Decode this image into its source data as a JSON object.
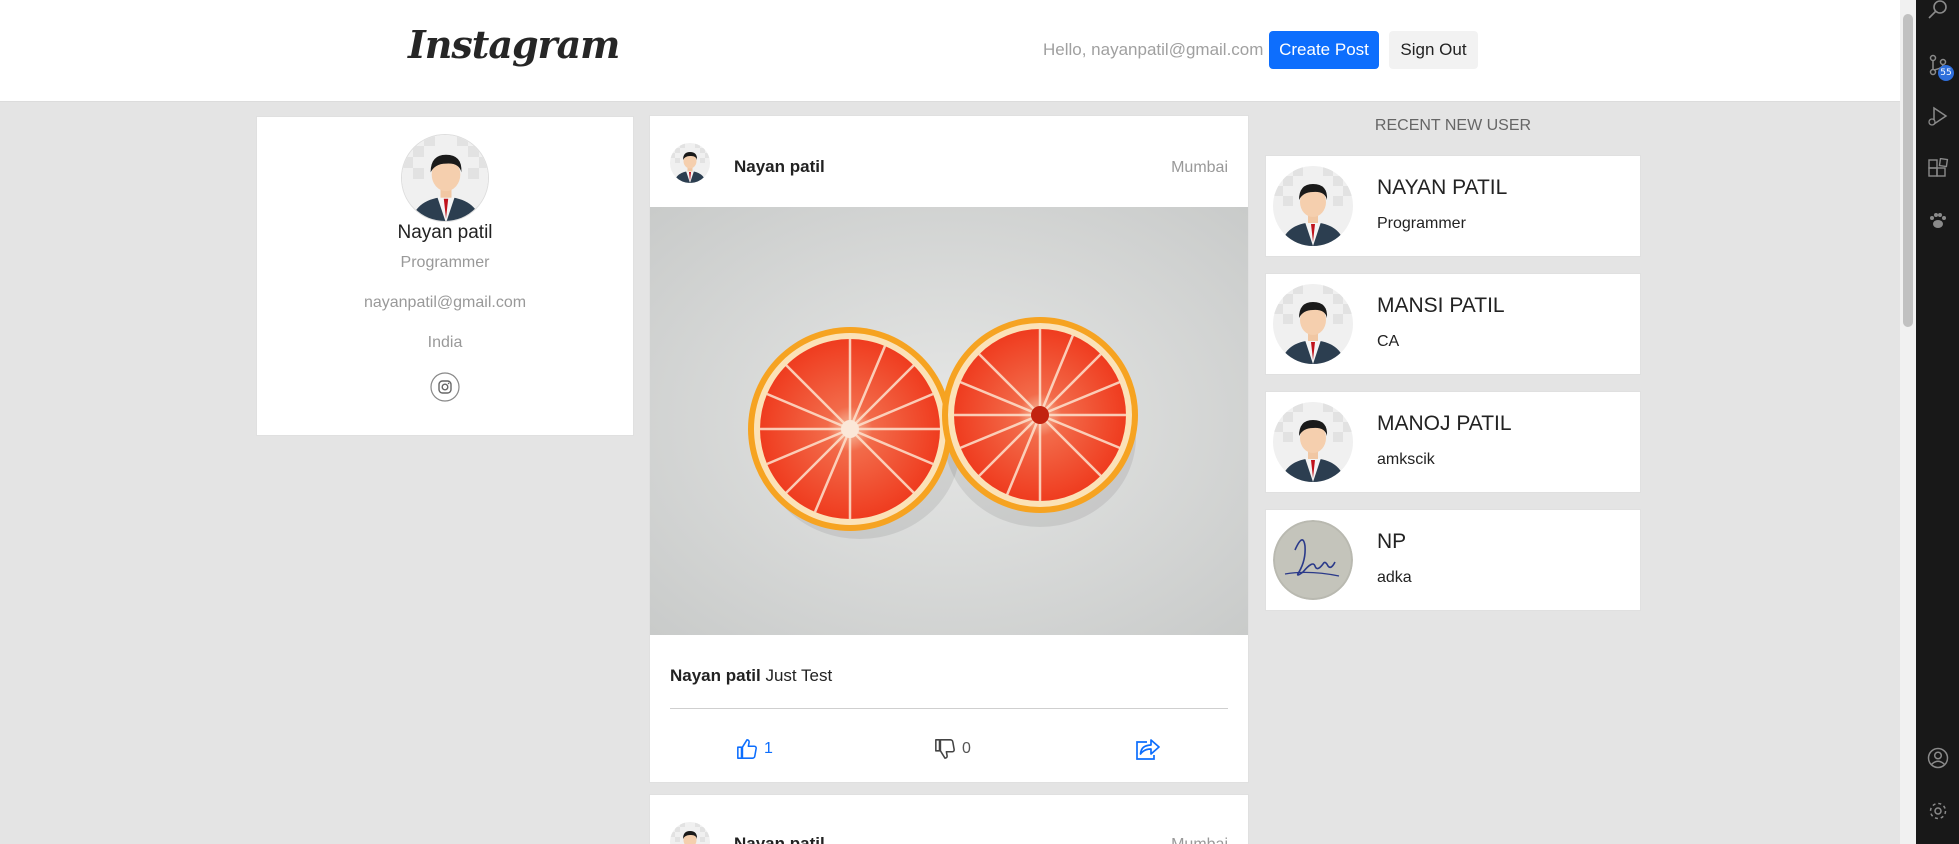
{
  "header": {
    "logo": "Instagram",
    "greeting": "Hello, nayanpatil@gmail.com",
    "create_post": "Create Post",
    "sign_out": "Sign Out"
  },
  "profile": {
    "name": "Nayan patil",
    "role": "Programmer",
    "email": "nayanpatil@gmail.com",
    "country": "India",
    "icon": "instagram-icon"
  },
  "post": {
    "author": "Nayan patil",
    "location": "Mumbai",
    "caption_author": "Nayan patil",
    "caption_text": "Just Test",
    "likes": "1",
    "dislikes": "0"
  },
  "post2": {
    "author": "Nayan patil",
    "location": "Mumbai"
  },
  "recent": {
    "title": "RECENT NEW USER",
    "users": [
      {
        "name": "NAYAN PATIL",
        "role": "Programmer"
      },
      {
        "name": "MANSI PATIL",
        "role": "CA"
      },
      {
        "name": "MANOJ PATIL",
        "role": "amkscik"
      },
      {
        "name": "NP",
        "role": "adka"
      }
    ]
  },
  "activity_bar": {
    "badge": "55",
    "icons": [
      "search-icon",
      "source-control-icon",
      "run-debug-icon",
      "extensions-icon",
      "paw-icon",
      "account-icon",
      "settings-icon"
    ]
  },
  "colors": {
    "accent": "#0d6efd",
    "background": "#e4e4e4"
  }
}
